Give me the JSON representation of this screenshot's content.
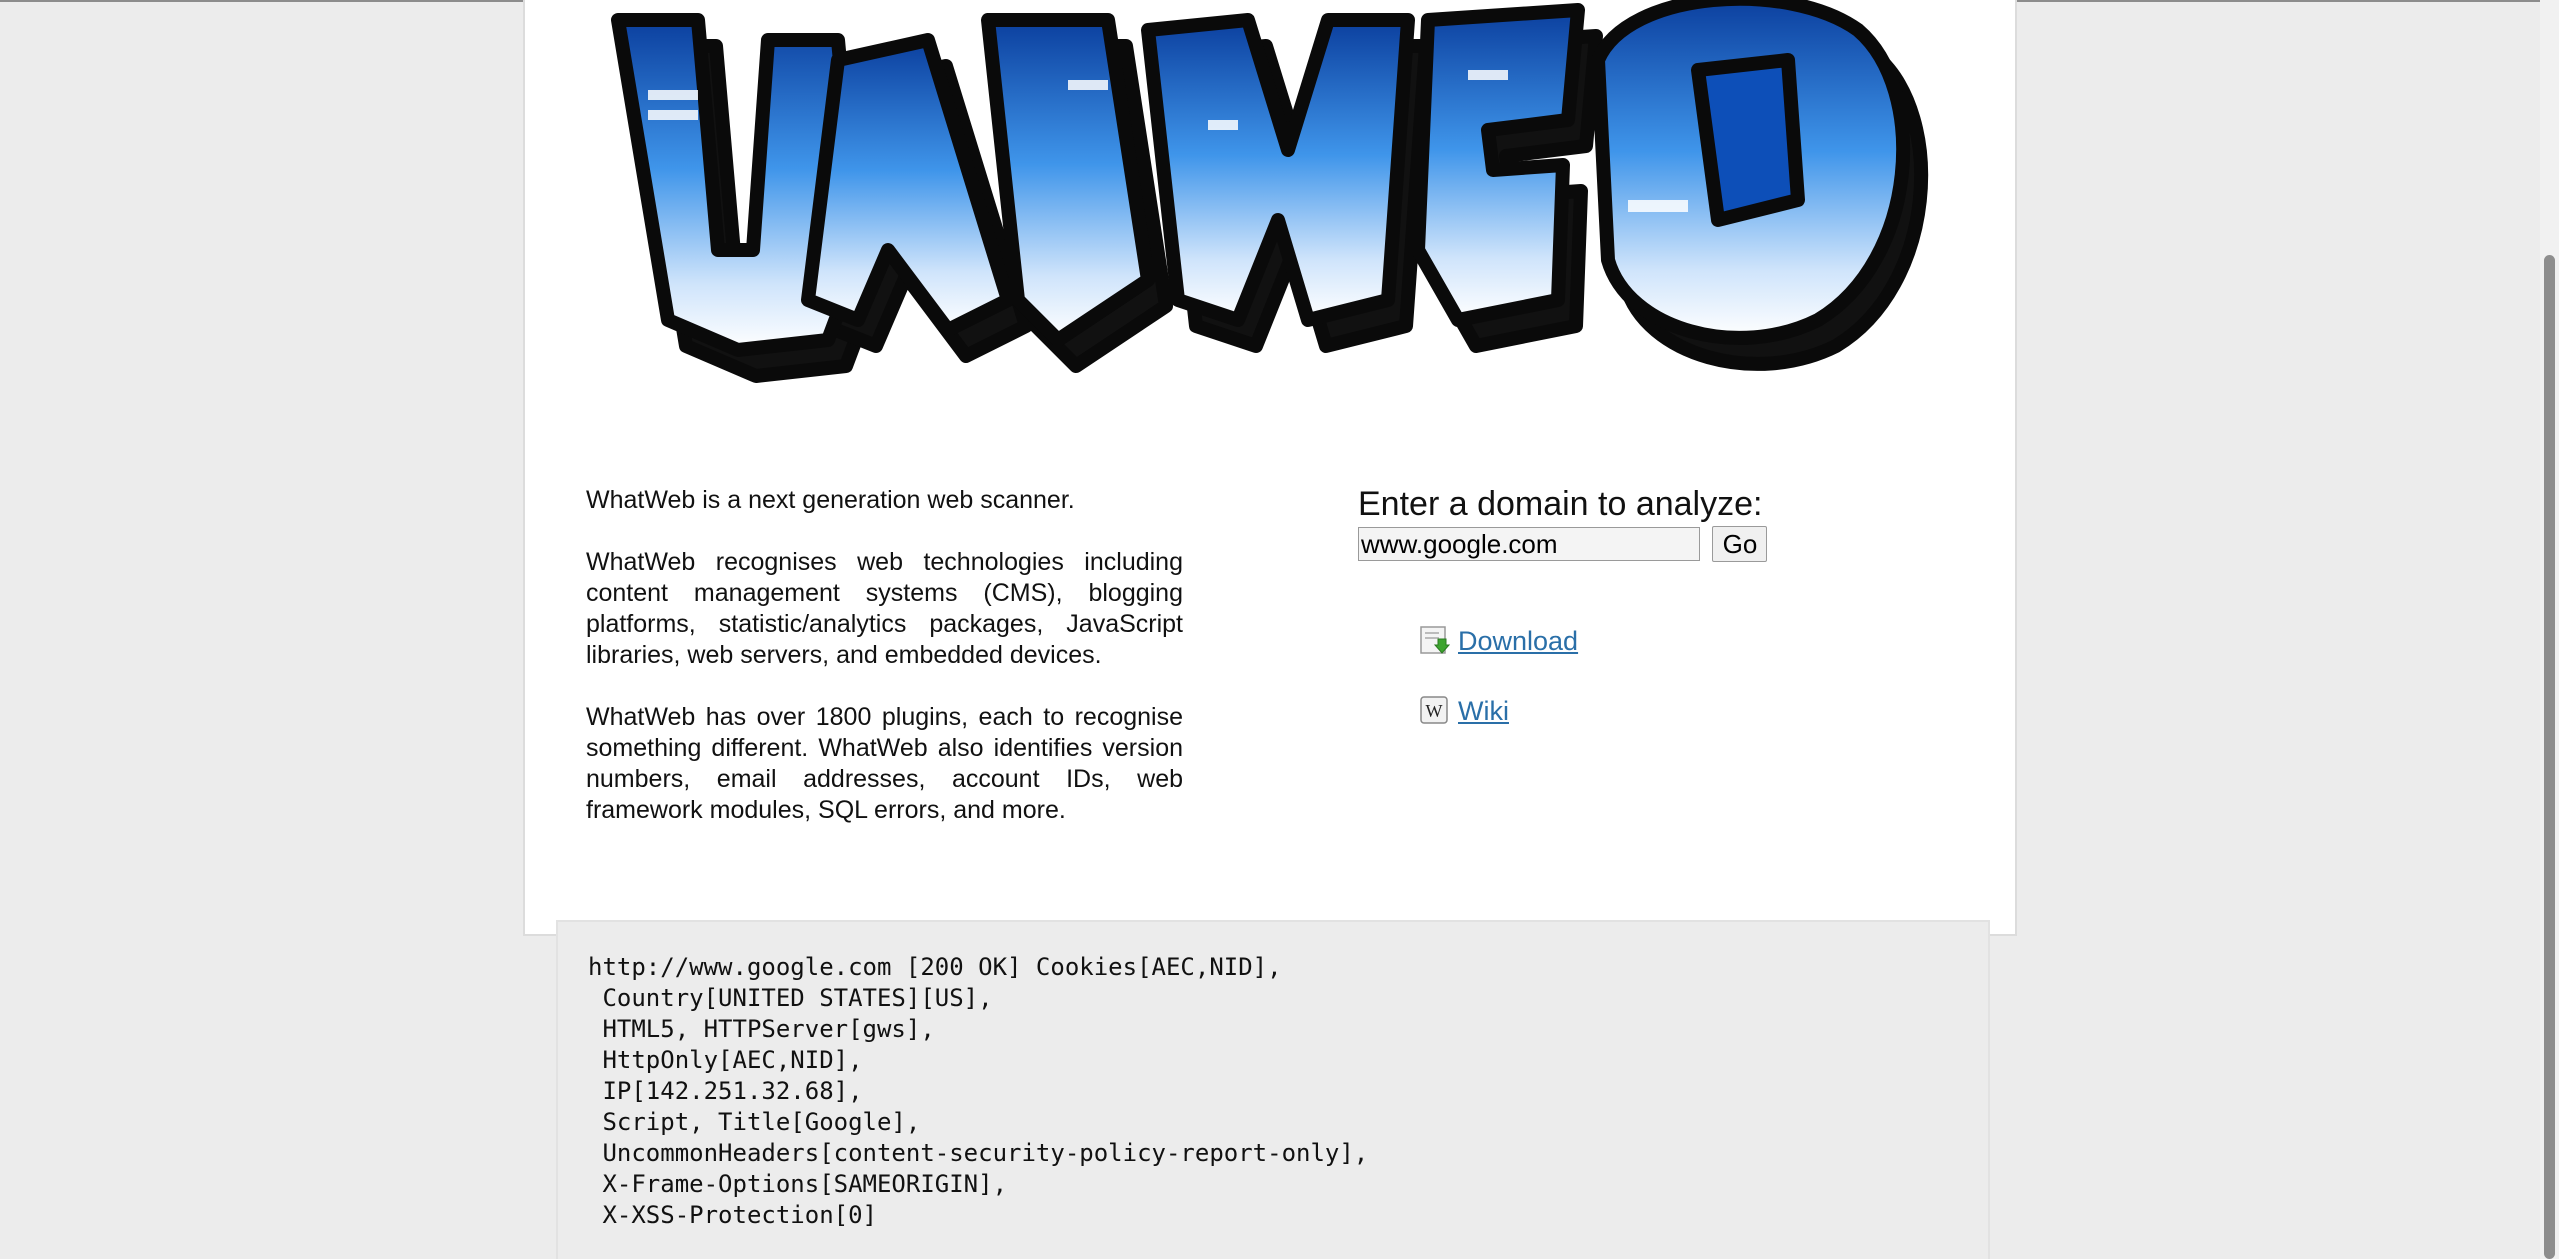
{
  "logo": {
    "alt": "WhatWeb"
  },
  "about": {
    "p1": "WhatWeb is a next generation web scanner.",
    "p2": "WhatWeb recognises web technologies including content management systems (CMS), blogging platforms, statistic/analytics packages, JavaScript libraries, web servers, and embedded devices.",
    "p3": "WhatWeb has over 1800 plugins, each to recognise something different. WhatWeb also identifies version numbers, email addresses, account IDs, web framework modules, SQL errors, and more."
  },
  "analyze": {
    "heading": "Enter a domain to analyze:",
    "domain_value": "www.google.com",
    "go_label": "Go"
  },
  "links": [
    {
      "label": "Download",
      "icon": "download-icon"
    },
    {
      "label": "Wiki",
      "icon": "wiki-icon"
    }
  ],
  "result": {
    "lines": [
      "http://www.google.com [200 OK] Cookies[AEC,NID],",
      " Country[UNITED STATES][US],",
      " HTML5, HTTPServer[gws],",
      " HttpOnly[AEC,NID],",
      " IP[142.251.32.68],",
      " Script, Title[Google],",
      " UncommonHeaders[content-security-policy-report-only],",
      " X-Frame-Options[SAMEORIGIN],",
      " X-XSS-Protection[0]"
    ]
  },
  "colors": {
    "page_bg": "#ececec",
    "panel_bg": "#ffffff",
    "link": "#2a6fa8",
    "logo_blue": "#2f7fd8",
    "logo_dark": "#101010"
  }
}
